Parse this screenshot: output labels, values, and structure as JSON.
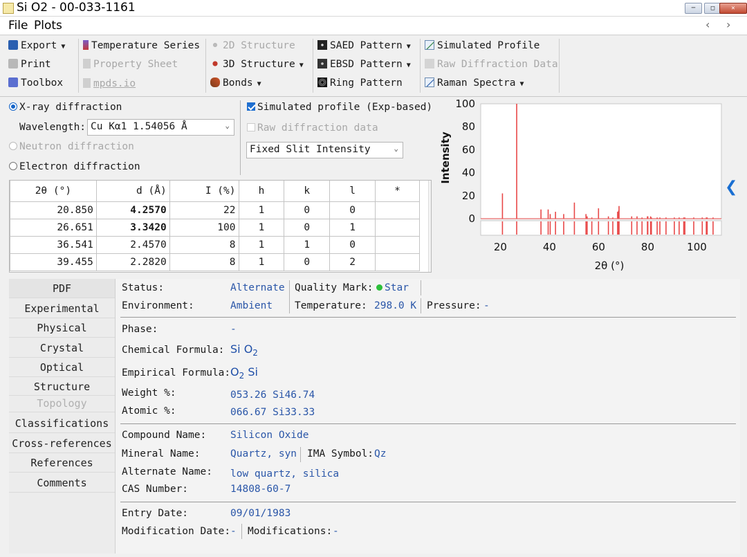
{
  "window": {
    "title": "Si O2 - 00-033-1161"
  },
  "menu": {
    "items": [
      "File",
      "Plots"
    ]
  },
  "toolbar": {
    "export": "Export",
    "print": "Print",
    "toolbox": "Toolbox",
    "temperature_series": "Temperature Series",
    "property_sheet": "Property Sheet",
    "mpds": "mpds.io",
    "structure_2d": "2D Structure",
    "structure_3d": "3D Structure",
    "bonds": "Bonds",
    "saed": "SAED Pattern",
    "ebsd": "EBSD Pattern",
    "ring": "Ring Pattern",
    "simulated_profile": "Simulated Profile",
    "raw_diffraction": "Raw Diffraction Data",
    "raman": "Raman Spectra"
  },
  "options": {
    "xray": "X-ray diffraction",
    "wavelength_label": "Wavelength:",
    "wavelength_value": "Cu Kα1 1.54056 Å",
    "neutron": "Neutron diffraction",
    "electron": "Electron diffraction",
    "simulated_profile": "Simulated profile (Exp-based)",
    "raw_data": "Raw diffraction data",
    "intensity_mode": "Fixed Slit Intensity"
  },
  "peak_table": {
    "headers": [
      "2θ (°)",
      "d (Å)",
      "I (%)",
      "h",
      "k",
      "l",
      "*"
    ],
    "rows": [
      [
        "20.850",
        "4.2570",
        "22",
        "1",
        "0",
        "0",
        ""
      ],
      [
        "26.651",
        "3.3420",
        "100",
        "1",
        "0",
        "1",
        ""
      ],
      [
        "36.541",
        "2.4570",
        "8",
        "1",
        "1",
        "0",
        ""
      ],
      [
        "39.455",
        "2.2820",
        "8",
        "1",
        "0",
        "2",
        ""
      ]
    ]
  },
  "chart_data": {
    "type": "bar",
    "xlabel": "2θ (°)",
    "ylabel": "Intensity",
    "xlim": [
      12,
      110
    ],
    "ylim": [
      0,
      100
    ],
    "xticks": [
      20,
      40,
      60,
      80,
      100
    ],
    "yticks": [
      0,
      20,
      40,
      60,
      80,
      100
    ],
    "grid": false,
    "bar_color": "#e84848",
    "peaks": [
      {
        "x": 20.85,
        "y": 22
      },
      {
        "x": 26.65,
        "y": 100
      },
      {
        "x": 36.54,
        "y": 8
      },
      {
        "x": 39.46,
        "y": 8
      },
      {
        "x": 40.3,
        "y": 4
      },
      {
        "x": 42.45,
        "y": 6
      },
      {
        "x": 45.79,
        "y": 4
      },
      {
        "x": 50.14,
        "y": 14
      },
      {
        "x": 54.87,
        "y": 4
      },
      {
        "x": 55.33,
        "y": 2
      },
      {
        "x": 57.24,
        "y": 1
      },
      {
        "x": 59.96,
        "y": 9
      },
      {
        "x": 63.99,
        "y": 2
      },
      {
        "x": 65.79,
        "y": 1
      },
      {
        "x": 67.74,
        "y": 6
      },
      {
        "x": 68.14,
        "y": 7
      },
      {
        "x": 68.32,
        "y": 11
      },
      {
        "x": 73.47,
        "y": 2
      },
      {
        "x": 75.64,
        "y": 2
      },
      {
        "x": 77.68,
        "y": 1
      },
      {
        "x": 79.88,
        "y": 2
      },
      {
        "x": 80.04,
        "y": 2
      },
      {
        "x": 81.17,
        "y": 2
      },
      {
        "x": 81.49,
        "y": 1
      },
      {
        "x": 83.84,
        "y": 1
      },
      {
        "x": 84.95,
        "y": 1
      },
      {
        "x": 87.44,
        "y": 1
      },
      {
        "x": 90.83,
        "y": 1
      },
      {
        "x": 92.79,
        "y": 1
      },
      {
        "x": 94.66,
        "y": 1
      },
      {
        "x": 95.12,
        "y": 1
      },
      {
        "x": 98.74,
        "y": 1
      },
      {
        "x": 102.2,
        "y": 1
      },
      {
        "x": 103.85,
        "y": 1
      },
      {
        "x": 104.2,
        "y": 1
      },
      {
        "x": 106.6,
        "y": 1
      }
    ]
  },
  "nav": {
    "items": [
      "PDF",
      "Experimental",
      "Physical",
      "Crystal",
      "Optical",
      "Structure",
      "Topology",
      "Classifications",
      "Cross-references",
      "References",
      "Comments"
    ]
  },
  "detail": {
    "status_label": "Status:",
    "status_value": "Alternate",
    "quality_label": "Quality Mark:",
    "quality_value": "Star",
    "environment_label": "Environment:",
    "environment_value": "Ambient",
    "temperature_label": "Temperature:",
    "temperature_value": "298.0 K",
    "pressure_label": "Pressure:",
    "pressure_value": "-",
    "phase_label": "Phase:",
    "phase_value": "-",
    "chem_label": "Chemical Formula:",
    "chem_el1": "Si O",
    "chem_sub": "2",
    "emp_label": "Empirical Formula:",
    "emp_el1": "O",
    "emp_sub": "2",
    "emp_el2": " Si",
    "weight_label": "Weight %:",
    "weight_value": "053.26 Si46.74",
    "atomic_label": "Atomic %:",
    "atomic_value": "066.67 Si33.33",
    "compound_label": "Compound Name:",
    "compound_value": "Silicon Oxide",
    "mineral_label": "Mineral Name:",
    "mineral_value": "Quartz, syn",
    "ima_label": "IMA Symbol:",
    "ima_value": "Qz",
    "alt_label": "Alternate Name:",
    "alt_value": "low quartz, silica",
    "cas_label": "CAS Number:",
    "cas_value": "14808-60-7",
    "entry_label": "Entry Date:",
    "entry_value": "09/01/1983",
    "mod_date_label": "Modification Date:",
    "mod_date_value": "-",
    "mods_label": "Modifications:",
    "mods_value": "-"
  }
}
